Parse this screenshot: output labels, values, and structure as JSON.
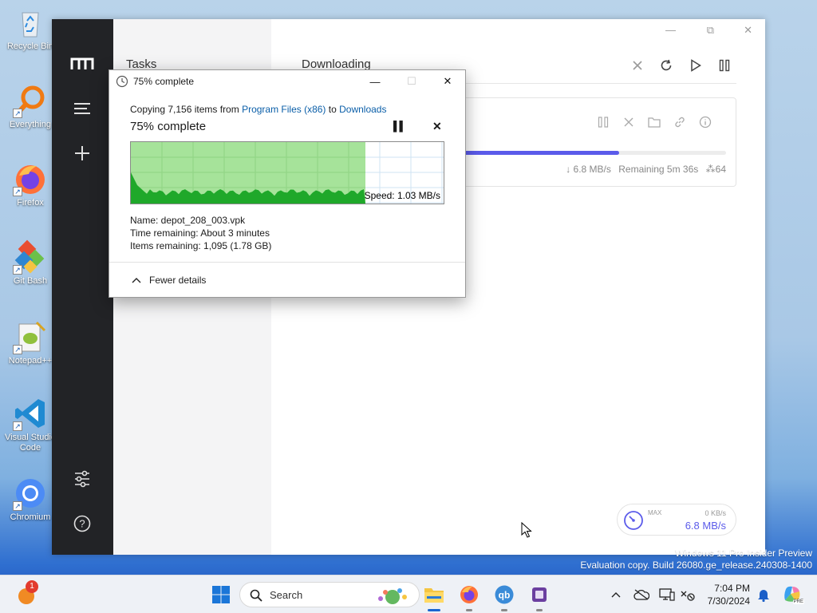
{
  "desktop": {
    "icons": [
      {
        "label": "Recycle Bin",
        "icon": "recycle-bin-icon"
      },
      {
        "label": "Everything",
        "icon": "everything-icon"
      },
      {
        "label": "Firefox",
        "icon": "firefox-icon"
      },
      {
        "label": "Git Bash",
        "icon": "git-bash-icon"
      },
      {
        "label": "Notepad++",
        "icon": "notepadpp-icon"
      },
      {
        "label": "Visual Studio Code",
        "icon": "vscode-icon"
      },
      {
        "label": "Chromium",
        "icon": "chromium-icon"
      }
    ],
    "watermark": {
      "line1": "Windows 11 Pro Insider Preview",
      "line2": "Evaluation copy. Build 26080.ge_release.240308-1400"
    }
  },
  "app": {
    "sidebar": {
      "logo_icon": "motrix-logo-icon",
      "menu_icon": "menu-icon",
      "add_icon": "plus-icon",
      "settings_icon": "sliders-icon",
      "help_icon": "help-icon"
    },
    "subnav_title": "Tasks",
    "main_title": "Downloading",
    "window_controls": {
      "minimize": "—",
      "restore": "⧉",
      "close": "✕"
    },
    "task": {
      "progress_pct": 74,
      "speed": "↓ 6.8 MB/s",
      "remaining": "Remaining 5m 36s",
      "connections": "64"
    },
    "speed_widget": {
      "max_label": "MAX",
      "upload": "0 KB/s",
      "download": "6.8 MB/s"
    }
  },
  "dialog": {
    "title": "75% complete",
    "copy_prefix": "Copying 7,156 items from ",
    "source": "Program Files (x86)",
    "copy_mid": " to ",
    "destination": "Downloads",
    "percent_text": "75% complete",
    "progress_fraction": 0.75,
    "speed_label": "Speed: 1.03 MB/s",
    "name": "Name:  depot_208_003.vpk",
    "time_remaining": "Time remaining:  About 3 minutes",
    "items_remaining": "Items remaining:  1,095 (1.78 GB)",
    "fewer_details": "Fewer details",
    "controls": {
      "minimize": "—",
      "maximize": "☐",
      "close": "✕"
    }
  },
  "taskbar": {
    "search_placeholder": "Search",
    "time": "7:04 PM",
    "date": "7/30/2024",
    "notification_count": "1",
    "pinned": [
      "start-icon",
      "search-icon",
      "file-explorer-icon",
      "firefox-icon",
      "qbittorrent-icon",
      "app-icon"
    ]
  }
}
